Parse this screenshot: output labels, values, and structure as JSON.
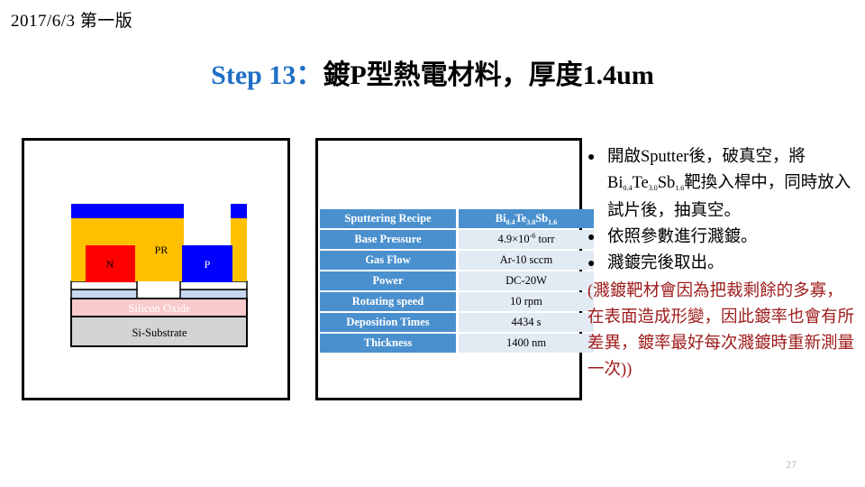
{
  "header": {
    "date_line": "2017/6/3 第一版",
    "title_en": "Step 13：",
    "title_cn": "鍍P型熱電材料，厚度1.4um"
  },
  "figure": {
    "label_n": "N",
    "label_pr": "PR",
    "label_p": "P",
    "label_oxide": "Silicon Oxide",
    "label_substrate": "Si-Substrate",
    "colors": {
      "photoresist": "#ffc000",
      "n_type": "#ff0000",
      "p_type": "#0000ff",
      "top_metal": "#0000ff",
      "oxide": "#f8cbcb",
      "substrate": "#d4d4d4",
      "electrode": "#c6d9f0",
      "outline": "#000000"
    }
  },
  "table": {
    "rows": [
      {
        "key": "Sputtering Recipe",
        "value_html": "Bi<sub>0.4</sub>Te<sub>3.0</sub>Sb<sub>1.6</sub>",
        "value_text": "Bi0.4Te3.0Sb1.6",
        "is_header": true
      },
      {
        "key": "Base Pressure",
        "value_html": "4.9×10<sup>-6</sup> torr",
        "value_text": "4.9×10-6 torr",
        "is_header": false
      },
      {
        "key": "Gas Flow",
        "value_html": "Ar-10 sccm",
        "value_text": "Ar-10 sccm",
        "is_header": false
      },
      {
        "key": "Power",
        "value_html": "DC-20W",
        "value_text": "DC-20W",
        "is_header": false
      },
      {
        "key": "Rotating speed",
        "value_html": "10 rpm",
        "value_text": "10 rpm",
        "is_header": false
      },
      {
        "key": "Deposition Times",
        "value_html": "4434 s",
        "value_text": "4434 s",
        "is_header": false
      },
      {
        "key": "Thickness",
        "value_html": "1400 nm",
        "value_text": "1400 nm",
        "is_header": false
      }
    ],
    "header_bg": "#4a90ce",
    "value_bg": "#e2eaf3"
  },
  "notes": {
    "bullet_glyph": "●",
    "bullets": [
      {
        "html": "開啟Sputter後，破真空，將Bi<sub>0.4</sub>Te<sub>3.0</sub>Sb<sub>1.6</sub>靶換入桿中，同時放入試片後，抽真空。",
        "text": "開啟Sputter後，破真空，將Bi0.4Te3.0Sb1.6靶換入桿中，同時放入試片後，抽真空。"
      },
      {
        "html": "依照參數進行濺鍍。",
        "text": "依照參數進行濺鍍。"
      },
      {
        "html": "濺鍍完後取出。",
        "text": "濺鍍完後取出。"
      }
    ],
    "red_note": "(濺鍍靶材會因為把裁剩餘的多寡，在表面造成形變，因此鍍率也會有所差異，鍍率最好每次濺鍍時重新測量一次))",
    "red_color": "#9e1b1b"
  },
  "footer": {
    "page_number": "27"
  }
}
